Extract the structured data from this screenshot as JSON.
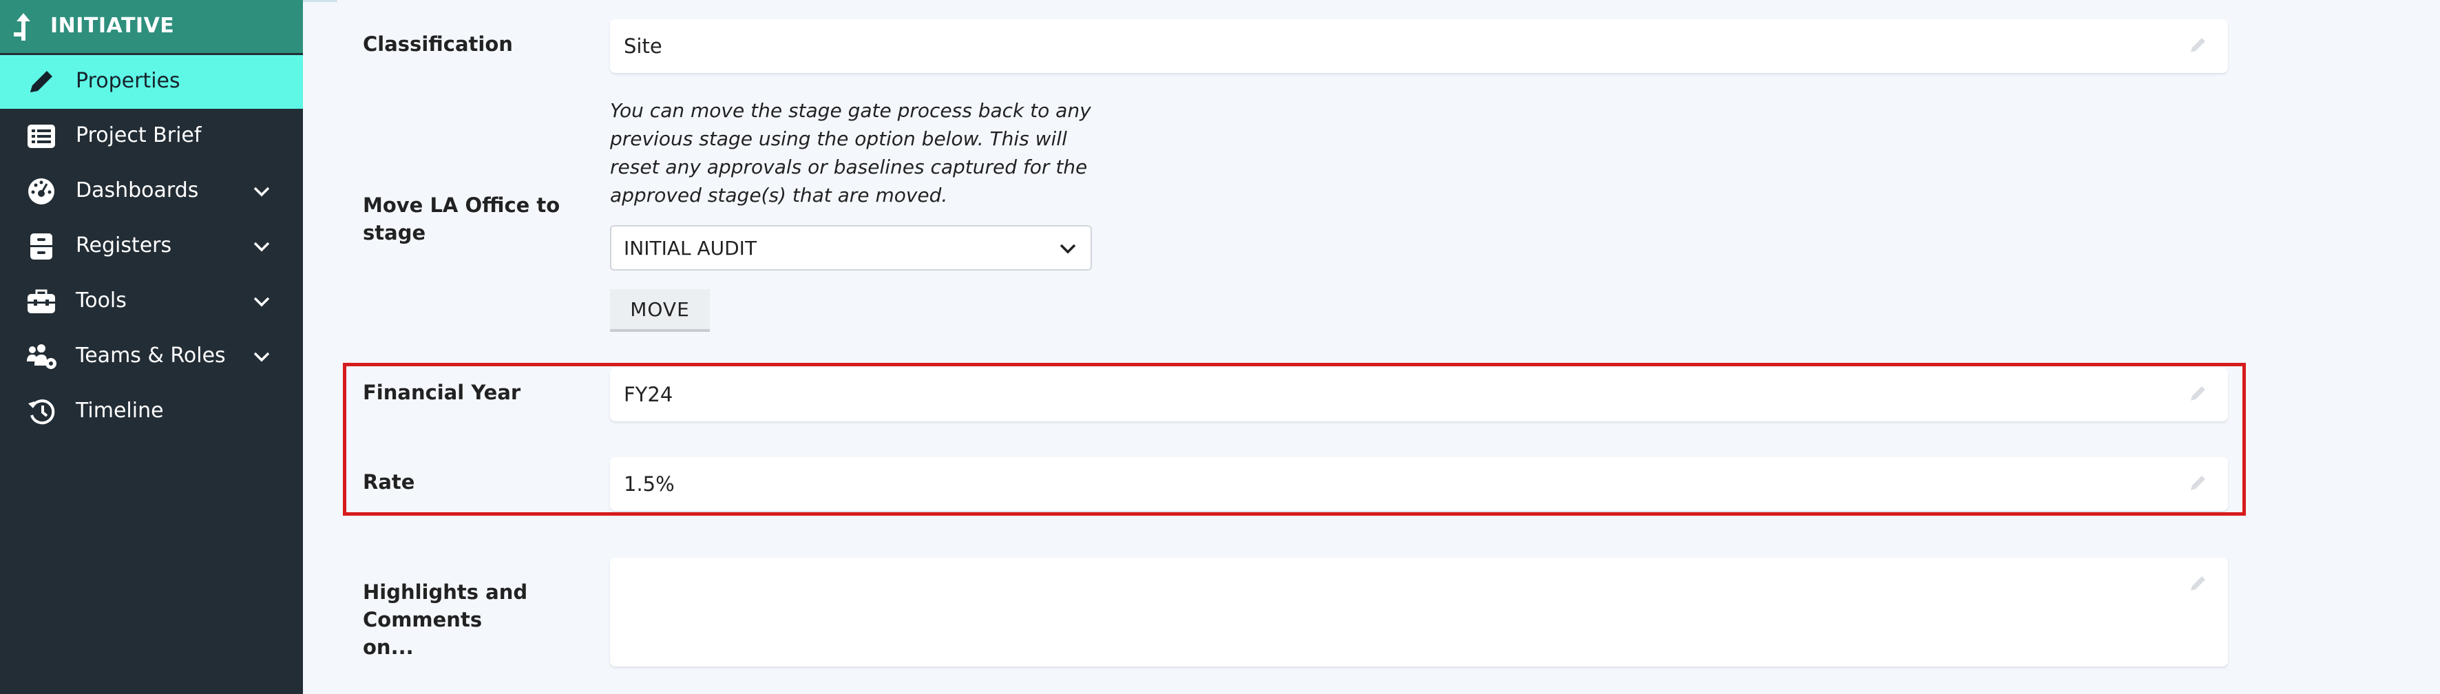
{
  "sidebar": {
    "header": {
      "label": "INITIATIVE",
      "icon": "arrow-up-turn-icon"
    },
    "items": [
      {
        "label": "Properties",
        "icon": "pencil-icon",
        "active": true
      },
      {
        "label": "Project Brief",
        "icon": "list-icon"
      },
      {
        "label": "Dashboards",
        "icon": "gauge-icon",
        "expandable": true
      },
      {
        "label": "Registers",
        "icon": "register-icon",
        "expandable": true
      },
      {
        "label": "Tools",
        "icon": "toolbox-icon",
        "expandable": true
      },
      {
        "label": "Teams & Roles",
        "icon": "users-gear-icon",
        "expandable": true
      },
      {
        "label": "Timeline",
        "icon": "history-icon"
      }
    ]
  },
  "form": {
    "classification": {
      "label": "Classification",
      "value": "Site"
    },
    "move_stage": {
      "label": "Move LA Office to stage",
      "note": "You can move the stage gate process back to any previous stage using the option below. This will reset any approvals or baselines captured for the approved stage(s) that are moved.",
      "selected": "INITIAL AUDIT",
      "button": "MOVE"
    },
    "financial_year": {
      "label": "Financial Year",
      "value": "FY24"
    },
    "rate": {
      "label": "Rate",
      "value": "1.5%"
    },
    "highlights": {
      "label": "Highlights and Comments on...",
      "value": ""
    }
  },
  "colors": {
    "sidebar_bg": "#232d35",
    "header_bg": "#2e8f7d",
    "active_bg": "#5ff8e6",
    "highlight_border": "#d61c1c"
  }
}
